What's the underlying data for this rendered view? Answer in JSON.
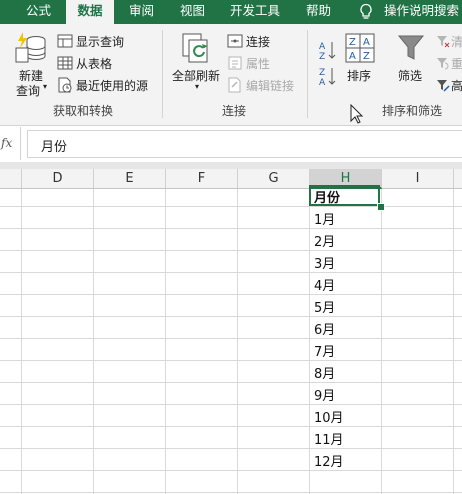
{
  "tabs": [
    {
      "label": "公式",
      "active": false
    },
    {
      "label": "数据",
      "active": true
    },
    {
      "label": "审阅",
      "active": false
    },
    {
      "label": "视图",
      "active": false
    },
    {
      "label": "开发工具",
      "active": false
    },
    {
      "label": "帮助",
      "active": false
    }
  ],
  "tell_me": "操作说明搜索",
  "ribbon": {
    "get_transform": {
      "new_query_line1": "新建",
      "new_query_line2": "查询",
      "show_queries": "显示查询",
      "from_table": "从表格",
      "recent_sources": "最近使用的源",
      "label": "获取和转换"
    },
    "connections": {
      "refresh_all": "全部刷新",
      "connections": "连接",
      "properties": "属性",
      "edit_links": "编辑链接",
      "label": "连接"
    },
    "sort_filter": {
      "sort": "排序",
      "filter": "筛选",
      "clear_partial": "清",
      "reapply_partial": "重",
      "advanced_partial": "高",
      "label": "排序和筛选"
    }
  },
  "formula_bar": {
    "fx": "fx",
    "value": "月份"
  },
  "columns": [
    "D",
    "E",
    "F",
    "G",
    "H",
    "I"
  ],
  "selected_column": "H",
  "column_h_cells": [
    "月份",
    "1月",
    "2月",
    "3月",
    "4月",
    "5月",
    "6月",
    "7月",
    "8月",
    "9月",
    "10月",
    "11月",
    "12月"
  ],
  "colors": {
    "accent": "#217346",
    "ribbon_bg": "#f3f3f3",
    "gridline": "#d9d9d9"
  }
}
